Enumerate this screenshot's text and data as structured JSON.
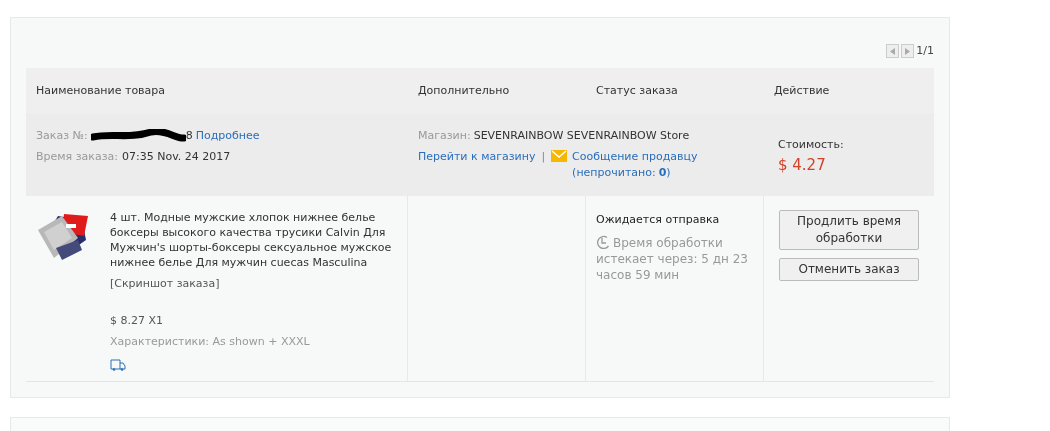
{
  "pager": {
    "text": "1/1"
  },
  "columns": [
    "Наименование товара",
    "Дополнительно",
    "Статус заказа",
    "Действие"
  ],
  "order": {
    "number_label": "Заказ №:",
    "number_visible": "8",
    "details_link": "Подробнее",
    "time_label": "Время заказа:",
    "time": "07:35 Nov. 24 2017",
    "store_label": "Магазин:",
    "store": "SEVENRAINBOW SEVENRAINBOW Store",
    "store_link": "Перейти к магазину",
    "separator": "|",
    "message_link": "Сообщение продавцу",
    "unread_label": "(непрочитано:",
    "unread_count": "0",
    "unread_close": ")",
    "cost_label": "Стоимость:",
    "cost": "$ 4.27"
  },
  "product": {
    "title": "4 шт. Модные мужские хлопок нижнее белье боксеры высокого качества трусики Calvin Для Мужчин's шорты-боксеры сексуальное мужское нижнее белье Для мужчин cuecas Masculina",
    "snapshot": "[Скриншот заказа]",
    "price": "$ 8.27 X1",
    "specs": "Характеристики: As shown + XXXL"
  },
  "status": {
    "title": "Ожидается отправка",
    "note": "Время обработки истекает через: 5 дн 23 часов 59 мин"
  },
  "actions": [
    "Продлить время обработки",
    "Отменить заказ"
  ]
}
